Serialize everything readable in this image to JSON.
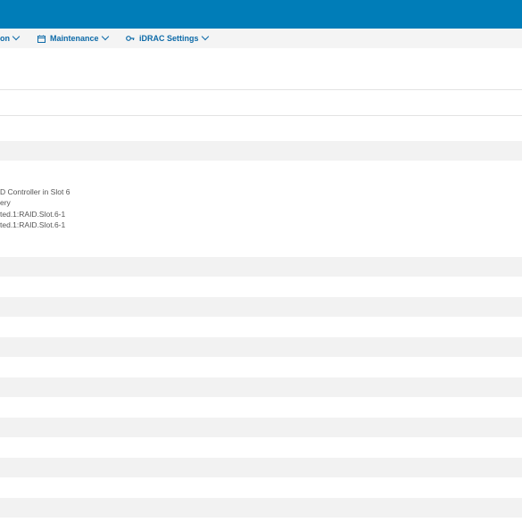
{
  "header": {
    "brand_color": "#007db8"
  },
  "nav": {
    "items": [
      {
        "label": "on",
        "icon": "none"
      },
      {
        "label": "Maintenance",
        "icon": "calendar-icon"
      },
      {
        "label": "iDRAC Settings",
        "icon": "key-icon"
      }
    ]
  },
  "details": {
    "lines": [
      "D Controller in Slot 6",
      "ery",
      "ted.1:RAID.Slot.6-1",
      "ted.1:RAID.Slot.6-1"
    ]
  }
}
